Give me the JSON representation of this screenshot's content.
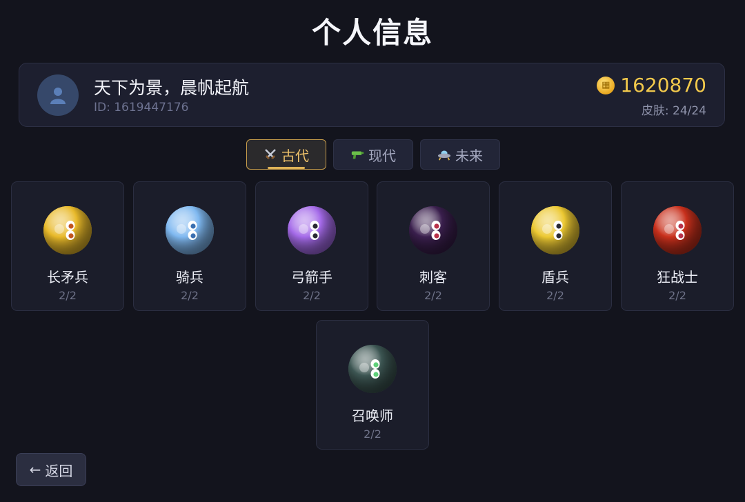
{
  "title": "个人信息",
  "profile": {
    "name": "天下为景，晨帆起航",
    "id_text": "ID: 1619447176",
    "coins": "1620870",
    "skins_text": "皮肤: 24/24"
  },
  "tabs": [
    {
      "label": "古代",
      "icon": "crossed-swords-icon",
      "active": true
    },
    {
      "label": "现代",
      "icon": "water-gun-icon",
      "active": false
    },
    {
      "label": "未来",
      "icon": "ufo-icon",
      "active": false
    }
  ],
  "units": [
    {
      "name": "长矛兵",
      "count": "2/2",
      "color": "#e8b92a",
      "pupil": "#c2561f"
    },
    {
      "name": "骑兵",
      "count": "2/2",
      "color": "#7fb8f0",
      "pupil": "#3a6fb0"
    },
    {
      "name": "弓箭手",
      "count": "2/2",
      "color": "#a46ae8",
      "pupil": "#2a2a33"
    },
    {
      "name": "刺客",
      "count": "2/2",
      "color": "#3a1f4d",
      "pupil": "#b8324a"
    },
    {
      "name": "盾兵",
      "count": "2/2",
      "color": "#ecc832",
      "pupil": "#2a2a33"
    },
    {
      "name": "狂战士",
      "count": "2/2",
      "color": "#c8301c",
      "pupil": "#b8324a"
    },
    {
      "name": "召唤师",
      "count": "2/2",
      "color": "#3c5552",
      "pupil": "#5fd07a"
    }
  ],
  "back_label": "返回",
  "colors": {
    "accent": "#efc26a",
    "coin": "#f2c94c",
    "background": "#13141d"
  }
}
